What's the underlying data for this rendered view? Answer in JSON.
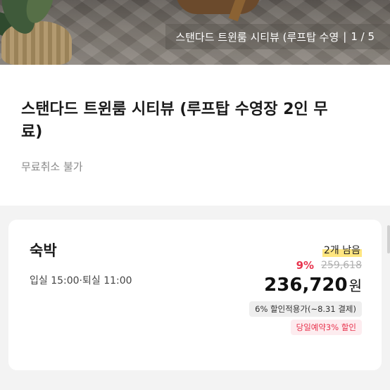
{
  "hero": {
    "caption": "스탠다드 트윈룸 시티뷰 (루프탑 수영",
    "separator": "|",
    "page_indicator": "1 / 5"
  },
  "room": {
    "title": "스탠다드 트윈룸 시티뷰 (루프탑 수영장 2인 무료)",
    "cancel_policy": "무료취소 불가"
  },
  "offer": {
    "type": "숙박",
    "checkin_checkout": "입실 15:00·퇴실 11:00",
    "rooms_left": "2개 남음",
    "discount_rate": "9%",
    "original_price": "259,618",
    "price": "236,720",
    "currency": "원",
    "card_discount_tag": "6% 할인적용가(~8.31 결제)",
    "same_day_tag": "당일예약3% 할인"
  },
  "colors": {
    "accent_red": "#e8344e",
    "highlight_yellow": "#ffe680",
    "band_gray": "#f3f3f3"
  }
}
